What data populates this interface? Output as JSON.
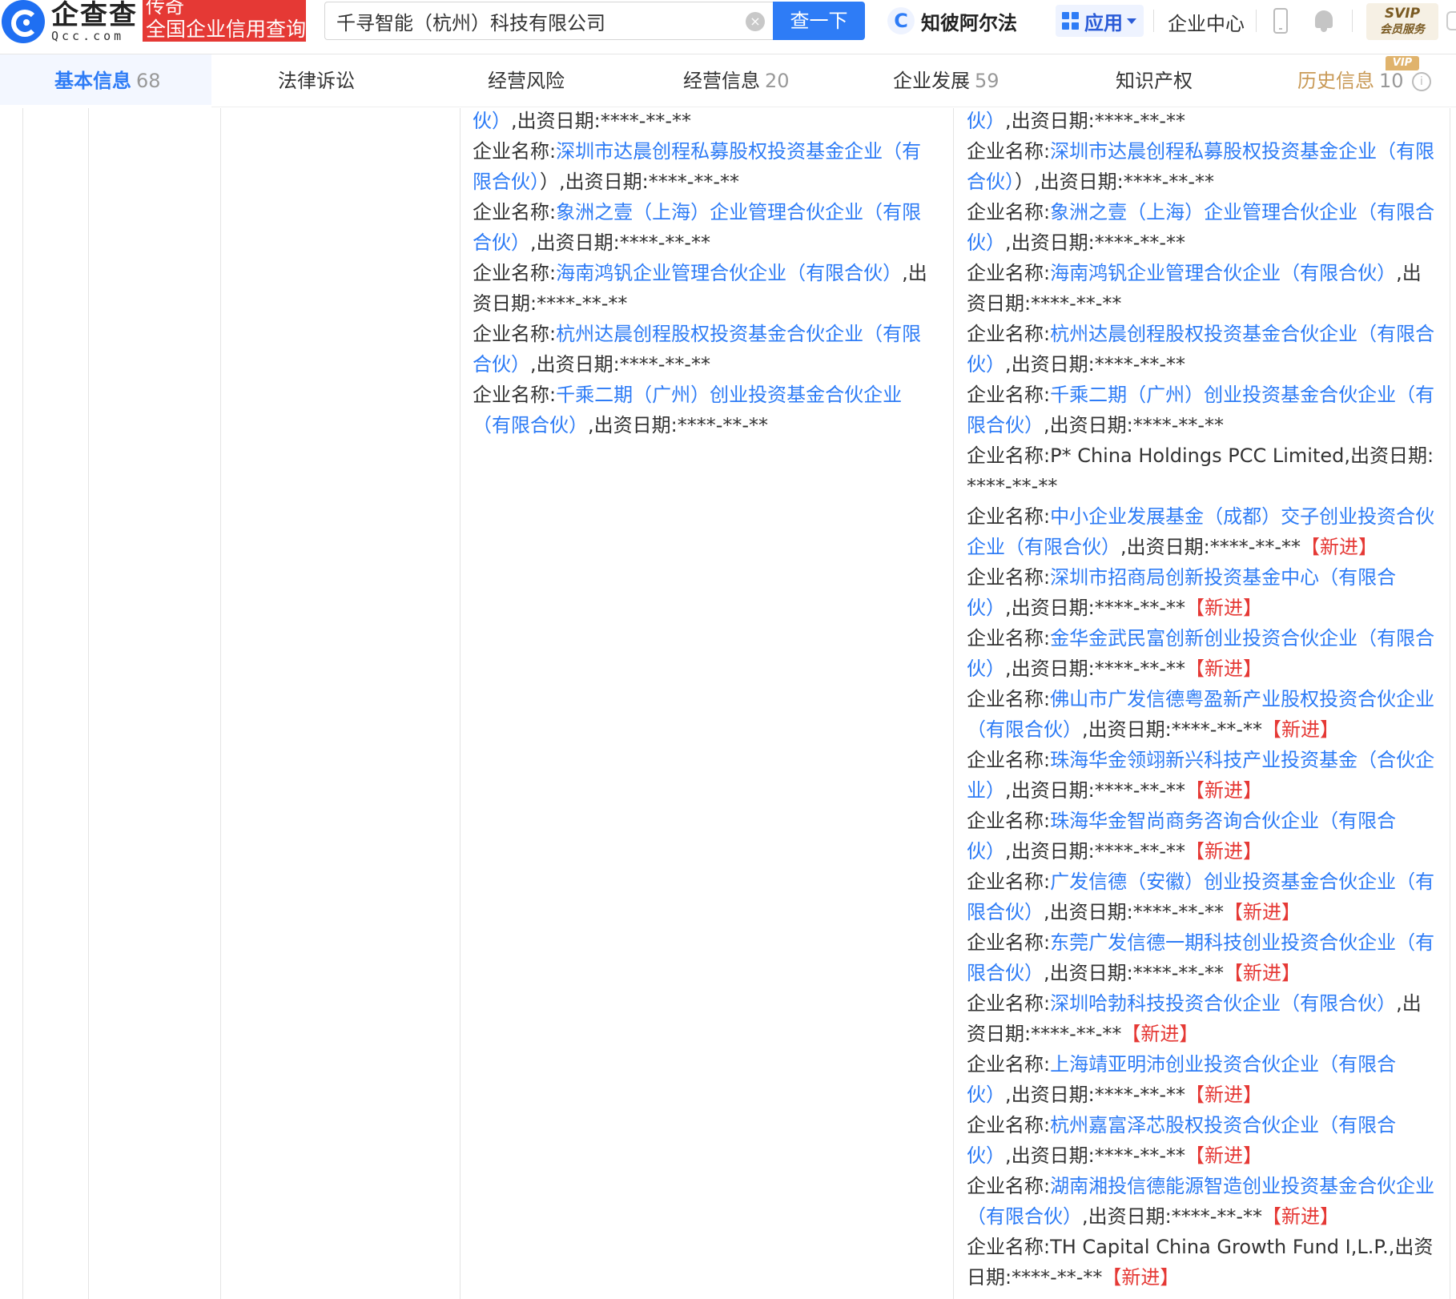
{
  "header": {
    "logo_cn": "企查查",
    "logo_en": "Qcc.com",
    "badge_line1": "传奇",
    "badge_line2": "全国企业信用查询",
    "search_value": "千寻智能（杭州）科技有限公司",
    "search_button": "查一下",
    "zhibi_label": "知彼阿尔法",
    "apps_label": "应用",
    "enterprise_center": "企业中心",
    "svip_line1": "SVIP",
    "svip_line2": "会员服务"
  },
  "tabs": [
    {
      "label": "基本信息",
      "count": "68"
    },
    {
      "label": "法律诉讼",
      "count": ""
    },
    {
      "label": "经营风险",
      "count": ""
    },
    {
      "label": "经营信息",
      "count": "20"
    },
    {
      "label": "企业发展",
      "count": "59"
    },
    {
      "label": "知识产权",
      "count": ""
    },
    {
      "label": "历史信息",
      "count": "10"
    }
  ],
  "vip_tag": "VIP",
  "colors": {
    "accent": "#2e7cf6",
    "new": "#e53935",
    "history": "#c99a57"
  },
  "column_before": {
    "lead": "伙）",
    "entries": [
      {
        "prefix": "企业名称:",
        "name": "深圳市达晨创程私募股权投资基金企业（有限合伙）",
        "suffix": "）,出资日期:****-**-**",
        "tag": ""
      },
      {
        "prefix": "企业名称:",
        "name": "象洲之壹（上海）企业管理合伙企业（有限合伙）",
        "suffix": ",出资日期:****-**-**",
        "tag": ""
      },
      {
        "prefix": "企业名称:",
        "name": "海南鸿钒企业管理合伙企业（有限合伙）",
        "suffix": ",出资日期:****-**-**",
        "tag": ""
      },
      {
        "prefix": "企业名称:",
        "name": "杭州达晨创程股权投资基金合伙企业（有限合伙）",
        "suffix": ",出资日期:****-**-**",
        "tag": ""
      },
      {
        "prefix": "企业名称:",
        "name": "千乘二期（广州）创业投资基金合伙企业（有限合伙）",
        "suffix": ",出资日期:****-**-**",
        "tag": ""
      }
    ]
  },
  "column_after": {
    "lead": "伙）",
    "entries": [
      {
        "prefix": "企业名称:",
        "name": "深圳市达晨创程私募股权投资基金企业（有限合伙）",
        "suffix": "）,出资日期:****-**-**",
        "tag": ""
      },
      {
        "prefix": "企业名称:",
        "name": "象洲之壹（上海）企业管理合伙企业（有限合伙）",
        "suffix": ",出资日期:****-**-**",
        "tag": ""
      },
      {
        "prefix": "企业名称:",
        "name": "海南鸿钒企业管理合伙企业（有限合伙）",
        "suffix": ",出资日期:****-**-**",
        "tag": ""
      },
      {
        "prefix": "企业名称:",
        "name": "杭州达晨创程股权投资基金合伙企业（有限合伙）",
        "suffix": ",出资日期:****-**-**",
        "tag": ""
      },
      {
        "prefix": "企业名称:",
        "name": "千乘二期（广州）创业投资基金合伙企业（有限合伙）",
        "suffix": ",出资日期:****-**-**",
        "tag": ""
      },
      {
        "prefix": "企业名称:",
        "name": "",
        "plain": "P* China Holdings PCC Limited",
        "suffix": ",出资日期:****-**-**",
        "tag": ""
      },
      {
        "prefix": "企业名称:",
        "name": "中小企业发展基金（成都）交子创业投资合伙企业（有限合伙）",
        "suffix": ",出资日期:****-**-**",
        "tag": "【新进】"
      },
      {
        "prefix": "企业名称:",
        "name": "深圳市招商局创新投资基金中心（有限合伙）",
        "suffix": ",出资日期:****-**-**",
        "tag": "【新进】"
      },
      {
        "prefix": "企业名称:",
        "name": "金华金武民富创新创业投资合伙企业（有限合伙）",
        "suffix": ",出资日期:****-**-**",
        "tag": "【新进】"
      },
      {
        "prefix": "企业名称:",
        "name": "佛山市广发信德粤盈新产业股权投资合伙企业（有限合伙）",
        "suffix": ",出资日期:****-**-**",
        "tag": "【新进】"
      },
      {
        "prefix": "企业名称:",
        "name": "珠海华金领翊新兴科技产业投资基金（合伙企业）",
        "suffix": ",出资日期:****-**-**",
        "tag": "【新进】"
      },
      {
        "prefix": "企业名称:",
        "name": "珠海华金智尚商务咨询合伙企业（有限合伙）",
        "suffix": ",出资日期:****-**-**",
        "tag": "【新进】"
      },
      {
        "prefix": "企业名称:",
        "name": "广发信德（安徽）创业投资基金合伙企业（有限合伙）",
        "suffix": ",出资日期:****-**-**",
        "tag": "【新进】"
      },
      {
        "prefix": "企业名称:",
        "name": "东莞广发信德一期科技创业投资合伙企业（有限合伙）",
        "suffix": ",出资日期:****-**-**",
        "tag": "【新进】"
      },
      {
        "prefix": "企业名称:",
        "name": "深圳哈勃科技投资合伙企业（有限合伙）",
        "suffix": ",出资日期:****-**-**",
        "tag": "【新进】"
      },
      {
        "prefix": "企业名称:",
        "name": "上海靖亚明沛创业投资合伙企业（有限合伙）",
        "suffix": ",出资日期:****-**-**",
        "tag": "【新进】"
      },
      {
        "prefix": "企业名称:",
        "name": "杭州嘉富泽芯股权投资合伙企业（有限合伙）",
        "suffix": ",出资日期:****-**-**",
        "tag": "【新进】"
      },
      {
        "prefix": "企业名称:",
        "name": "湖南湘投信德能源智造创业投资基金合伙企业（有限合伙）",
        "suffix": ",出资日期:****-**-**",
        "tag": "【新进】"
      },
      {
        "prefix": "企业名称:",
        "name": "",
        "plain": "TH Capital China Growth Fund I,L.P.",
        "suffix": ",出资日期:****-**-**",
        "tag": "【新进】"
      }
    ]
  }
}
